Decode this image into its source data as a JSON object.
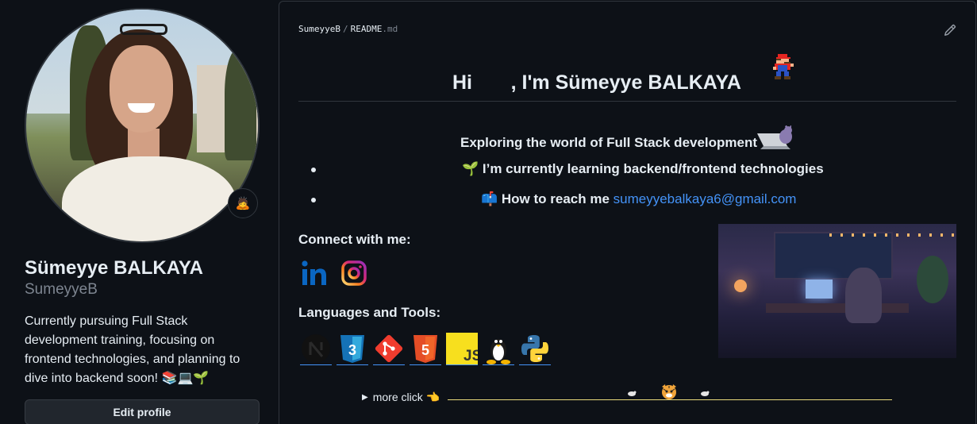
{
  "profile": {
    "name": "Sümeyye BALKAYA",
    "username": "SumeyyeB",
    "bio": "Currently pursuing Full Stack development training, focusing on frontend technologies, and planning to dive into backend soon! 📚💻🌱",
    "status_emoji": "🙇",
    "edit_button": "Edit profile"
  },
  "readme": {
    "breadcrumb_user": "SumeyyeB",
    "breadcrumb_sep": "/",
    "breadcrumb_file": "README",
    "breadcrumb_ext": ".md",
    "title": "Hi       , I'm Sümeyye BALKAYA",
    "subtitle": "Exploring the world of Full Stack development",
    "bullets": {
      "learning": "🌱 I’m currently learning backend/frontend technologies",
      "reach_prefix": "📫 How to reach me ",
      "email": "sumeyyebalkaya6@gmail.com"
    },
    "connect_heading": "Connect with me:",
    "socials": [
      "linkedin-icon",
      "instagram-icon"
    ],
    "tools_heading": "Languages and Tools:",
    "tools": [
      "nextjs-icon",
      "css3-icon",
      "git-icon",
      "html5-icon",
      "javascript-icon",
      "linux-icon",
      "python-icon"
    ],
    "details_summary": "more click 👈"
  },
  "colors": {
    "background": "#0d1117",
    "border": "#30363d",
    "text": "#e6edf3",
    "muted": "#7d8590",
    "link": "#4493f8",
    "footer_line": "#e9d97b"
  }
}
